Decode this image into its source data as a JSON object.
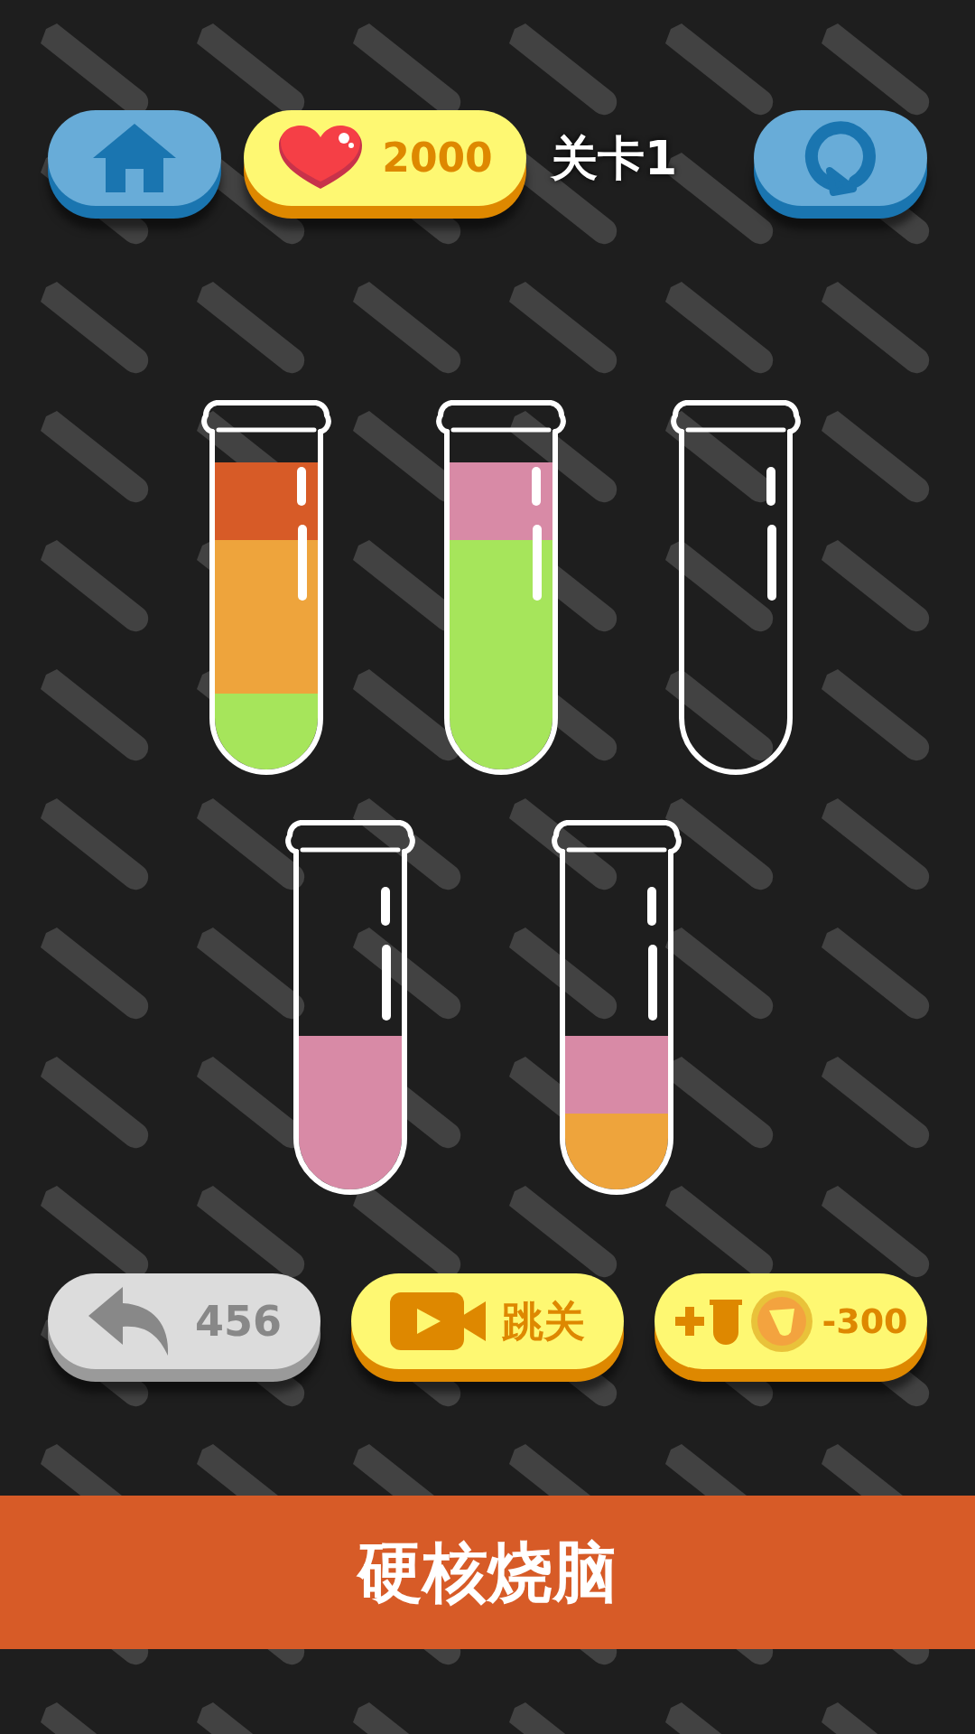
{
  "top_bar": {
    "hearts": "2000",
    "level_title": "关卡1"
  },
  "tube_rows": [
    {
      "tubes": [
        {
          "selected": false,
          "layers": [
            {
              "color": "#a6e55b"
            },
            {
              "color": "#eea43c"
            },
            {
              "color": "#eea43c"
            },
            {
              "color": "#d75b27"
            }
          ]
        },
        {
          "selected": false,
          "layers": [
            {
              "color": "#a6e55b"
            },
            {
              "color": "#a6e55b"
            },
            {
              "color": "#a6e55b"
            },
            {
              "color": "#d88aa6"
            }
          ]
        },
        {
          "selected": false
        }
      ]
    },
    {
      "tubes": [
        {
          "selected": false,
          "layers": [
            {
              "color": "#d88aa6"
            },
            {
              "color": "#d88aa6"
            }
          ]
        },
        {
          "selected": false,
          "layers": [
            {
              "color": "#eea43c"
            },
            {
              "color": "#d88aa6"
            }
          ]
        }
      ]
    }
  ],
  "actions": {
    "undo_count": "456",
    "skip_label": "跳关",
    "add_tube_cost": "-300"
  },
  "banner": {
    "text": "硬核烧脑"
  }
}
